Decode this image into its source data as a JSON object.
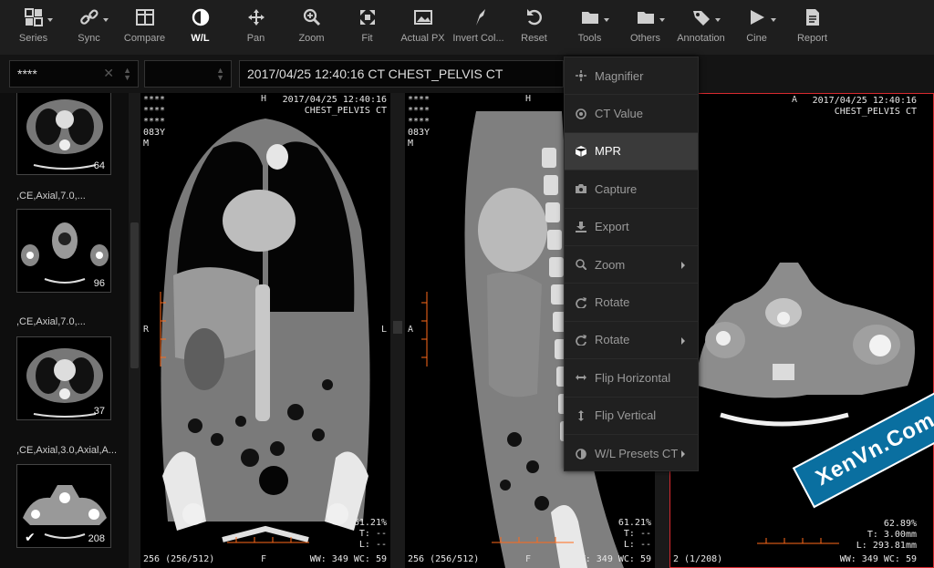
{
  "toolbar": [
    {
      "label": "Series",
      "icon": "grid-icon",
      "caret": true
    },
    {
      "label": "Sync",
      "icon": "link-icon",
      "caret": true
    },
    {
      "label": "Compare",
      "icon": "compare-icon",
      "caret": false
    },
    {
      "label": "W/L",
      "icon": "contrast-icon",
      "caret": false,
      "active": true
    },
    {
      "label": "Pan",
      "icon": "move-icon",
      "caret": false
    },
    {
      "label": "Zoom",
      "icon": "zoom-icon",
      "caret": false
    },
    {
      "label": "Fit",
      "icon": "fit-icon",
      "caret": false
    },
    {
      "label": "Actual PX",
      "icon": "image-icon",
      "caret": false
    },
    {
      "label": "Invert Col...",
      "icon": "invert-icon",
      "caret": false
    },
    {
      "label": "Reset",
      "icon": "reset-icon",
      "caret": false
    },
    {
      "label": "Tools",
      "icon": "folder-icon",
      "caret": true
    },
    {
      "label": "Others",
      "icon": "folder-icon",
      "caret": true
    },
    {
      "label": "Annotation",
      "icon": "tag-icon",
      "caret": true
    },
    {
      "label": "Cine",
      "icon": "play-icon",
      "caret": true
    },
    {
      "label": "Report",
      "icon": "report-icon",
      "caret": false
    }
  ],
  "filter": {
    "patient_value": "****",
    "study_title": "2017/04/25 12:40:16 CT CHEST_PELVIS CT"
  },
  "thumbnails": [
    {
      "count": "64",
      "label": ",CE,Axial,7.0,..."
    },
    {
      "count": "96",
      "label": ",CE,Axial,7.0,..."
    },
    {
      "count": "37",
      "label": ",CE,Axial,3.0,Axial,A..."
    },
    {
      "count": "208",
      "label": ""
    }
  ],
  "viewports": [
    {
      "tl": "****\n****\n****\n083Y\nM",
      "tr": "2017/04/25 12:40:16\nCHEST_PELVIS CT",
      "top": "H",
      "left": "R",
      "right": "L",
      "bottom": "F",
      "br": "61.21%\nT: --\nL: --",
      "bl": "256 (256/512)",
      "wl": "WW: 349 WC: 59"
    },
    {
      "tl": "****\n****\n****\n083Y\nM",
      "top": "H",
      "left": "A",
      "bottom": "F",
      "br": "61.21%\nT: --\nL: --",
      "bl": "256 (256/512)",
      "wl": "WW: 349 WC: 59"
    },
    {
      "tr": "2017/04/25 12:40:16\nCHEST_PELVIS CT",
      "top": "A",
      "br": "62.89%\nT: 3.00mm\nL: 293.81mm",
      "bl": "2 (1/208)",
      "wl": "WW: 349 WC: 59"
    }
  ],
  "context_menu": [
    {
      "label": "Magnifier",
      "icon": "magnifier-icon",
      "submenu": false
    },
    {
      "label": "CT Value",
      "icon": "target-icon",
      "submenu": false
    },
    {
      "label": "MPR",
      "icon": "cube-icon",
      "submenu": false,
      "active": true
    },
    {
      "label": "Capture",
      "icon": "camera-icon",
      "submenu": false
    },
    {
      "label": "Export",
      "icon": "download-icon",
      "submenu": false
    },
    {
      "label": "Zoom",
      "icon": "zoom-icon",
      "submenu": true
    },
    {
      "label": "Rotate",
      "icon": "rotate-icon",
      "submenu": false
    },
    {
      "label": "Rotate",
      "icon": "rotate-icon",
      "submenu": true
    },
    {
      "label": "Flip Horizontal",
      "icon": "flip-horizontal-icon",
      "submenu": false
    },
    {
      "label": "Flip Vertical",
      "icon": "flip-vertical-icon",
      "submenu": false
    },
    {
      "label": "W/L Presets CT",
      "icon": "contrast-icon",
      "submenu": true
    }
  ],
  "watermark": "XenVn.Com",
  "colors": {
    "accent": "#ff6a1a",
    "active_border": "#d8292f",
    "toolbar_bg": "#1e1e1e"
  }
}
